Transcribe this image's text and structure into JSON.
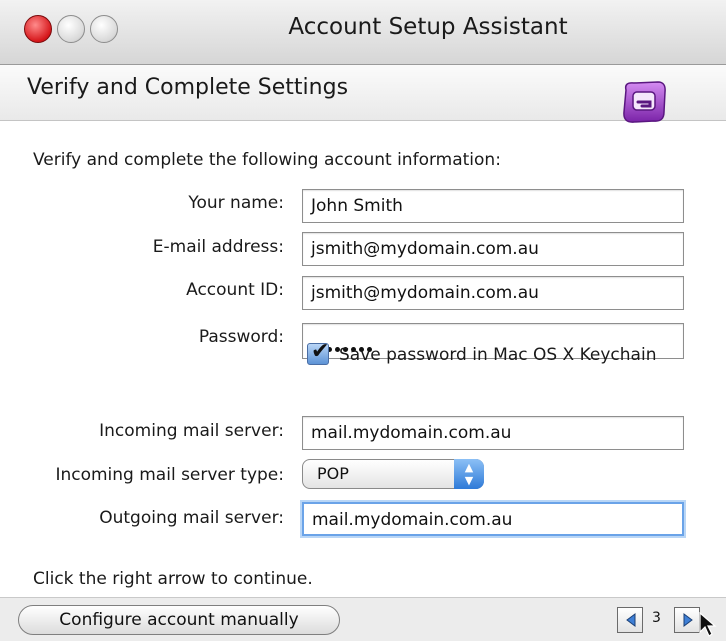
{
  "window": {
    "title": "Account Setup Assistant"
  },
  "header": {
    "title": "Verify and Complete Settings",
    "logo_icon": "entourage-logo-icon"
  },
  "intro": "Verify and complete the following account information:",
  "form": {
    "name_label": "Your name:",
    "name_value": "John Smith",
    "email_label": "E-mail address:",
    "email_value": "jsmith@mydomain.com.au",
    "account_id_label": "Account ID:",
    "account_id_value": "jsmith@mydomain.com.au",
    "password_label": "Password:",
    "password_masked_length": 8,
    "keychain_label": "Save password in Mac OS X Keychain",
    "keychain_checked": true,
    "incoming_label": "Incoming mail server:",
    "incoming_value": "mail.mydomain.com.au",
    "incoming_type_label": "Incoming mail server type:",
    "incoming_type_value": "POP",
    "outgoing_label": "Outgoing mail server:",
    "outgoing_value": "mail.mydomain.com.au"
  },
  "footer": {
    "instruction": "Click the right arrow to continue.",
    "configure_button": "Configure account manually",
    "page_number": "3"
  },
  "colors": {
    "accent": "#5d93d6",
    "close_light": "#d6171b",
    "logo": "#9b3fc6"
  }
}
